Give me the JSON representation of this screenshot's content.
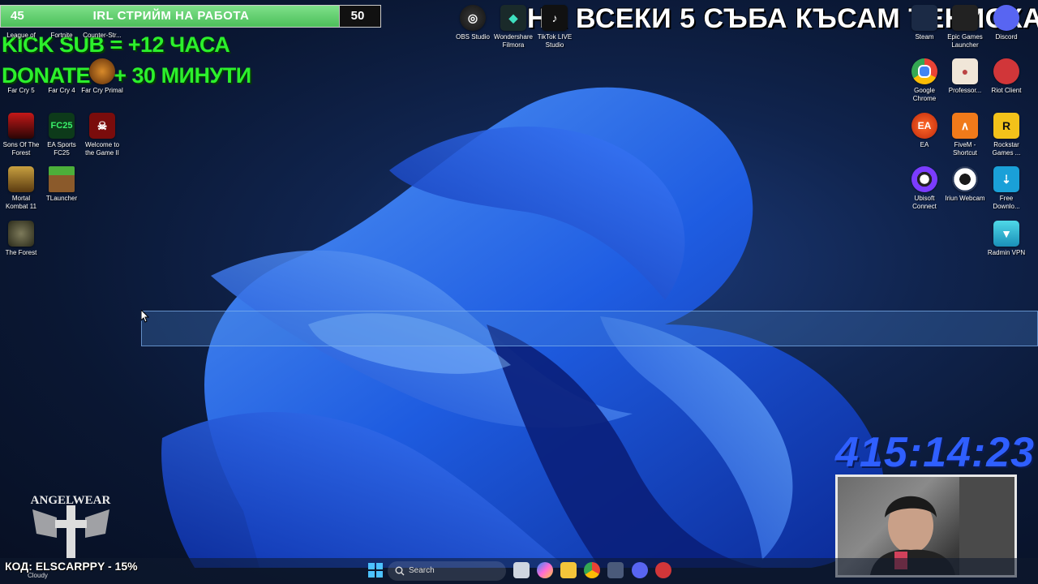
{
  "goal_bar": {
    "start": "45",
    "title": "IRL СТРИЙМ НА РАБОТА",
    "end": "50",
    "progress": 0.9
  },
  "overlay": {
    "kick_sub": "KICK SUB = +12 ЧАСА",
    "donate": "DONATE = + 30 МИНУТИ",
    "headline": "НА ВСЕКИ 5 СЪБА КЪСАМ ТЕНИСКА!",
    "timer": "415:14:23",
    "promo": "КОД: ELSCARPPY - 15%",
    "logo_text": "ANGELWEAR"
  },
  "desktop_icons": {
    "league": "League of",
    "fortnite": "Fortnite",
    "counter_strike": "Counter-Str...",
    "far_cry_5": "Far Cry 5",
    "far_cry_4": "Far Cry 4",
    "far_cry_primal": "Far Cry Primal",
    "sons_forest": "Sons Of The Forest",
    "ea_fc25": "EA Sports FC25",
    "welcome_game": "Welcome to the Game II",
    "mortal_kombat": "Mortal Kombat 11",
    "tlauncher": "TLauncher",
    "the_forest": "The Forest",
    "obs": "OBS Studio",
    "filmora": "Wondershare Filmora",
    "tiktok": "TikTok LIVE Studio",
    "steam": "Steam",
    "epic": "Epic Games Launcher",
    "discord": "Discord",
    "chrome": "Google Chrome",
    "professor": "Professor...",
    "riot": "Riot Client",
    "ea": "EA",
    "fivem": "FiveM - Shortcut",
    "rockstar": "Rockstar Games ...",
    "ubisoft": "Ubisoft Connect",
    "iriun": "Iriun Webcam",
    "free_download": "Free Downlo...",
    "radmin": "Radmin VPN"
  },
  "taskbar": {
    "search_placeholder": "Search",
    "weather": "Cloudy"
  },
  "colors": {
    "overlay_green": "#2cf02c",
    "timer_blue": "#2f5fff",
    "goal_green": "#5ccc68"
  }
}
